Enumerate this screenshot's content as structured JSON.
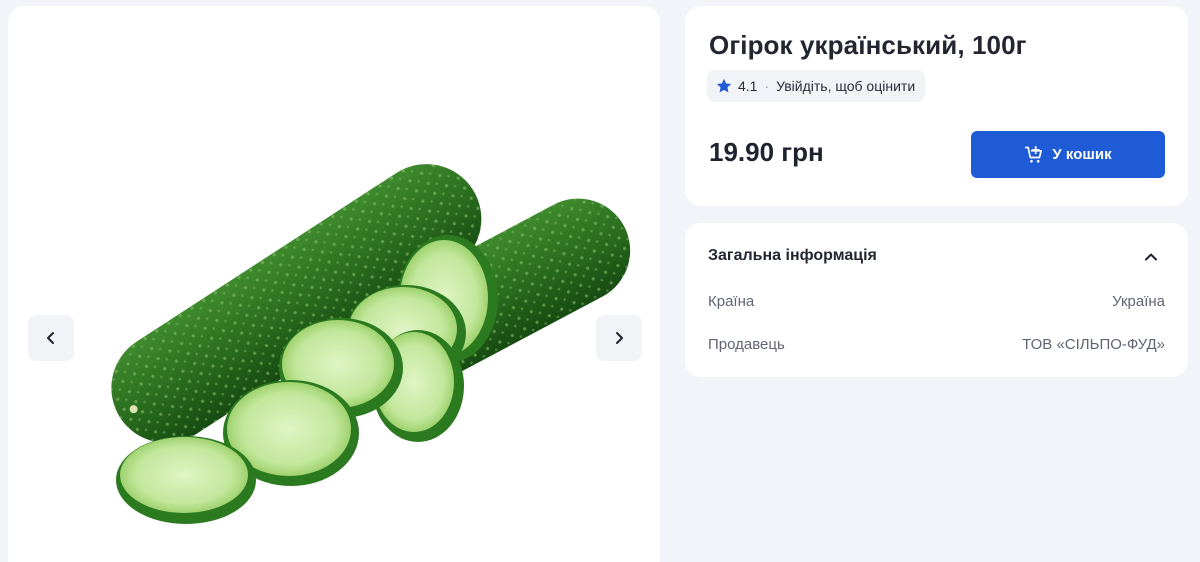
{
  "product": {
    "title": "Огірок український, 100г",
    "rating_value": "4.1",
    "rating_separator": "·",
    "rating_prompt": "Увійдіть, щоб оцінити",
    "price": "19.90 грн"
  },
  "actions": {
    "add_to_cart_label": "У кошик"
  },
  "info": {
    "heading": "Загальна інформація",
    "rows": [
      {
        "label": "Країна",
        "value": "Україна"
      },
      {
        "label": "Продавець",
        "value": "ТОВ «СІЛЬПО-ФУД»"
      }
    ]
  },
  "icons": {
    "rating": "star-icon",
    "cart": "cart-plus-icon",
    "prev": "chevron-left-icon",
    "next": "chevron-right-icon",
    "collapse": "chevron-up-icon"
  },
  "colors": {
    "accent": "#1f5bd6",
    "star": "#1f5bd6",
    "background": "#f2f4f9",
    "card": "#ffffff"
  }
}
